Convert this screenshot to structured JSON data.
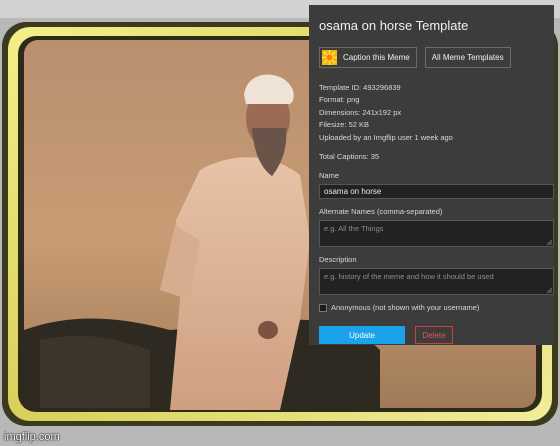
{
  "panel": {
    "title": "osama on horse Template",
    "caption_button_label": "Caption this Meme",
    "all_templates_button_label": "All Meme Templates",
    "template_id": "Template ID: 493296839",
    "format": "Format: png",
    "dimensions": "Dimensions: 241x192 px",
    "filesize": "Filesize: 52 KB",
    "uploaded_by": "Uploaded by an Imgflip user 1 week ago",
    "total_captions": "Total Captions: 35",
    "name_label": "Name",
    "name_value": "osama on horse",
    "alt_names_label": "Alternate Names (comma-separated)",
    "alt_names_placeholder": "e.g. All the Things",
    "description_label": "Description",
    "description_placeholder": "e.g. history of the meme and how it should be used",
    "anonymous_label": "Anonymous (not shown with your username)",
    "update_label": "Update",
    "delete_label": "Delete"
  },
  "watermark": "imgflip.com",
  "colors": {
    "panel_bg": "#3c3c3c",
    "update_button": "#1aa3ea",
    "delete_button": "#e8544f"
  },
  "icons": {
    "caption_button_icon": "yellow-sunburst-caption-icon"
  }
}
